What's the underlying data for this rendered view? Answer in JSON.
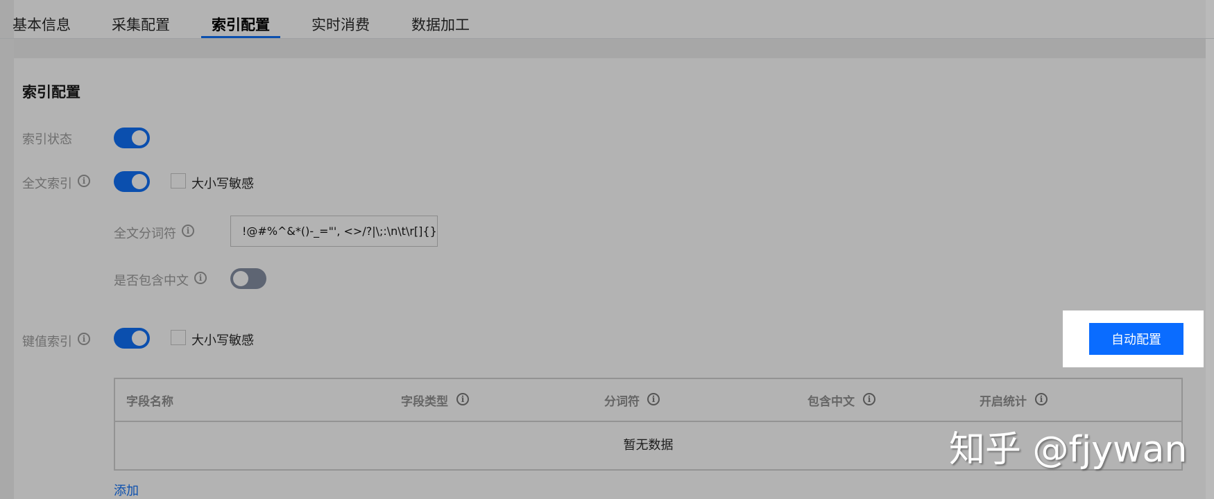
{
  "tabs": [
    {
      "label": "基本信息"
    },
    {
      "label": "采集配置"
    },
    {
      "label": "索引配置"
    },
    {
      "label": "实时消费"
    },
    {
      "label": "数据加工"
    }
  ],
  "active_tab": "索引配置",
  "section": {
    "title": "索引配置"
  },
  "index_status": {
    "label": "索引状态",
    "enabled": true
  },
  "fulltext": {
    "label": "全文索引",
    "enabled": true,
    "case_sensitive_label": "大小写敏感",
    "case_sensitive": false,
    "delimiter_label": "全文分词符",
    "delimiter_value": "!@#%^&*()-_=\"', <>/?|\\;:\\n\\t\\r[]{}",
    "chinese_label": "是否包含中文",
    "chinese_enabled": false
  },
  "kv": {
    "label": "键值索引",
    "enabled": true,
    "case_sensitive_label": "大小写敏感",
    "case_sensitive": false,
    "auto_config_label": "自动配置"
  },
  "table": {
    "columns": [
      "字段名称",
      "字段类型",
      "分词符",
      "包含中文",
      "开启统计"
    ],
    "empty_text": "暂无数据"
  },
  "add_label": "添加",
  "watermark": "知乎 @fjywan",
  "colors": {
    "primary": "#0b4fae",
    "button": "#0a6cff",
    "overlay": "#b3b3b3"
  }
}
